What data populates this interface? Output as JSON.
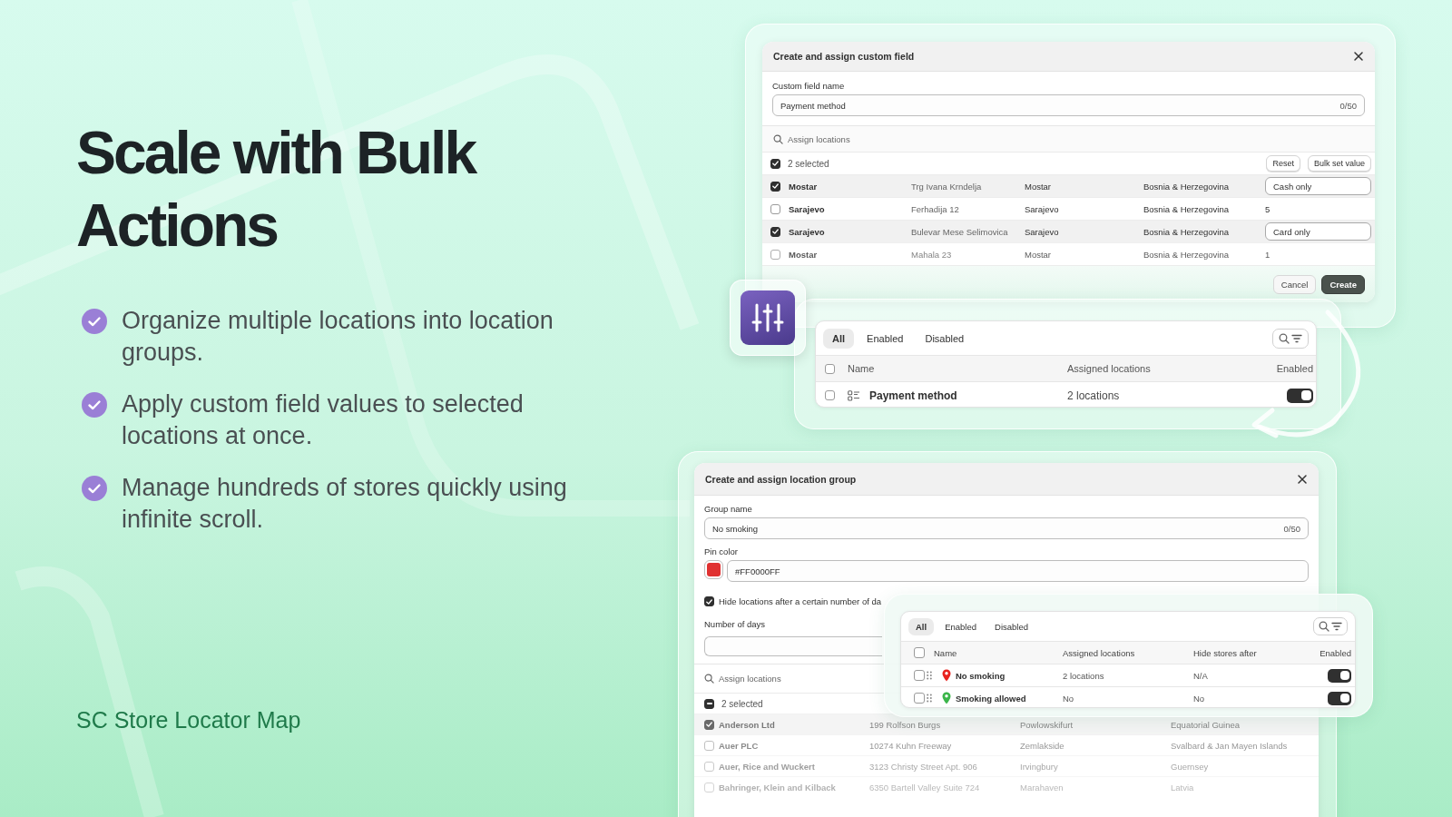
{
  "headline": "Scale with Bulk Actions",
  "features": [
    "Organize multiple locations into location groups.",
    "Apply custom field values to selected locations at once.",
    "Manage hundreds of stores quickly using infinite scroll."
  ],
  "brand": "SC Store Locator Map",
  "custom_field_dialog": {
    "title": "Create and assign custom field",
    "field_label": "Custom field name",
    "field_value": "Payment method",
    "counter": "0/50",
    "search_placeholder": "Assign locations",
    "select_all": {
      "checked": true
    },
    "selection": "2 selected",
    "buttons": [
      "Reset",
      "Bulk set value"
    ],
    "rows": [
      {
        "checked": true,
        "name": "Mostar",
        "address": "Trg Ivana Krndelja",
        "city": "Mostar",
        "country": "Bosnia & Herzegovina",
        "value": "Cash only",
        "kind": "field"
      },
      {
        "checked": false,
        "name": "Sarajevo",
        "address": "Ferhadija 12",
        "city": "Sarajevo",
        "country": "Bosnia & Herzegovina",
        "value": "5",
        "kind": "text"
      },
      {
        "checked": true,
        "name": "Sarajevo",
        "address": "Bulevar Mese Selimovica",
        "city": "Sarajevo",
        "country": "Bosnia & Herzegovina",
        "value": "Card only",
        "kind": "field"
      },
      {
        "checked": false,
        "name": "Mostar",
        "address": "Mahala 23",
        "city": "Mostar",
        "country": "Bosnia & Herzegovina",
        "value": "1",
        "kind": "text"
      }
    ],
    "footer_buttons": [
      {
        "label": "Cancel",
        "kind": "secondary"
      },
      {
        "label": "Create",
        "kind": "primary"
      }
    ]
  },
  "custom_fields_list": {
    "tabs": [
      {
        "label": "All",
        "selected": true
      },
      {
        "label": "Enabled",
        "selected": false
      },
      {
        "label": "Disabled",
        "selected": false
      }
    ],
    "select_all": {
      "checked": false
    },
    "columns": [
      "Name",
      "Assigned locations",
      "Enabled"
    ],
    "rows": [
      {
        "checked": false,
        "name": "Payment method",
        "assigned": "2 locations",
        "enabled": true
      }
    ]
  },
  "location_group_dialog": {
    "title": "Create and assign location group",
    "group_label": "Group name",
    "group_value": "No smoking",
    "counter": "0/50",
    "pin_label": "Pin color",
    "color": "#e03131",
    "pin_value": "#FF0000FF",
    "hide_checked": true,
    "hide_label": "Hide locations after a certain number of da",
    "days_label": "Number of days",
    "search_placeholder": "Assign locations",
    "select_all": {
      "indeterminate": true
    },
    "selection": "2 selected",
    "rows": [
      {
        "checked": true,
        "name": "Anderson Ltd",
        "address": "199 Rolfson Burgs",
        "city": "Powlowskifurt",
        "country": "Equatorial Guinea"
      },
      {
        "checked": false,
        "name": "Auer PLC",
        "address": "10274 Kuhn Freeway",
        "city": "Zemlakside",
        "country": "Svalbard & Jan Mayen Islands"
      },
      {
        "checked": false,
        "name": "Auer, Rice and Wuckert",
        "address": "3123 Christy Street Apt. 906",
        "city": "Irvingbury",
        "country": "Guernsey"
      },
      {
        "checked": false,
        "name": "Bahringer, Klein and Kilback",
        "address": "6350 Bartell Valley Suite 724",
        "city": "Marahaven",
        "country": "Latvia"
      }
    ]
  },
  "location_groups_list": {
    "tabs": [
      {
        "label": "All",
        "selected": true
      },
      {
        "label": "Enabled",
        "selected": false
      },
      {
        "label": "Disabled",
        "selected": false
      }
    ],
    "select_all": {
      "checked": false
    },
    "columns": [
      "Name",
      "Assigned locations",
      "Hide stores after",
      "Enabled"
    ],
    "rows": [
      {
        "checked": false,
        "name": "No smoking",
        "color": "#e8231f",
        "assigned": "2 locations",
        "hide_after": "N/A",
        "enabled": true
      },
      {
        "checked": false,
        "name": "Smoking allowed",
        "color": "#3bb54a",
        "assigned": "No",
        "hide_after": "No",
        "enabled": true
      }
    ]
  }
}
